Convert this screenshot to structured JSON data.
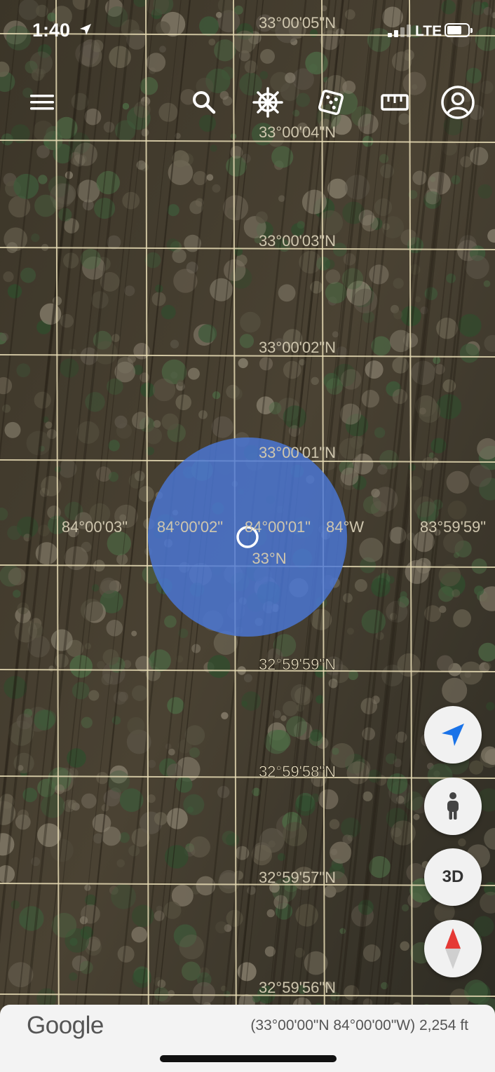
{
  "status_bar": {
    "time": "1:40",
    "network": "LTE"
  },
  "toolbar": {
    "menu_icon": "menu-icon",
    "search_icon": "search-icon",
    "voyager_icon": "ship-wheel-icon",
    "random_icon": "dice-icon",
    "measure_icon": "ruler-icon",
    "account_icon": "account-icon"
  },
  "map": {
    "latitude_labels": [
      "33°00'05\"N",
      "33°00'04\"N",
      "33°00'03\"N",
      "33°00'02\"N",
      "33°00'01\"N",
      "33°N",
      "32°59'59\"N",
      "32°59'58\"N",
      "32°59'57\"N",
      "32°59'56\"N"
    ],
    "longitude_labels": [
      "84°00'03\"",
      "84°00'02\"",
      "84°00'01\"",
      "84°W",
      "83°59'59\""
    ],
    "grid_color": "#e8dcb5",
    "accuracy_circle_color": "#4a78d8"
  },
  "controls": {
    "location_icon": "navigation-arrow-icon",
    "pegman_icon": "pegman-icon",
    "view_3d_label": "3D",
    "compass_icon": "compass-icon"
  },
  "footer": {
    "logo_text": "Google",
    "coordinates": "(33°00'00\"N 84°00'00\"W) 2,254 ft"
  }
}
